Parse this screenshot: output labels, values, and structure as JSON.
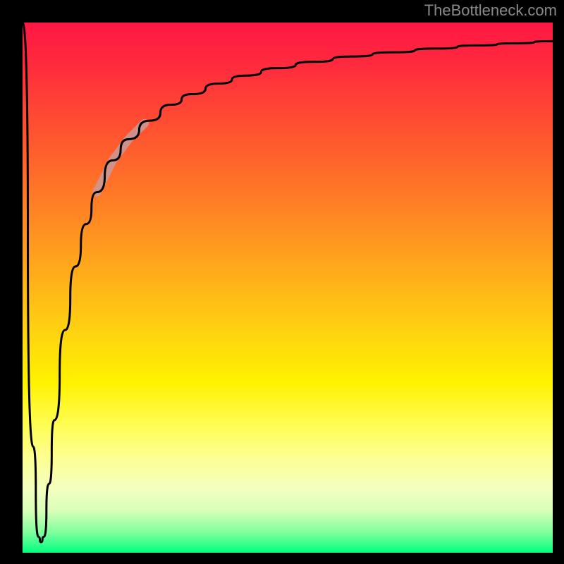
{
  "attribution": "TheBottleneck.com",
  "chart_data": {
    "type": "line",
    "title": "",
    "xlabel": "",
    "ylabel": "",
    "xlim": [
      0,
      1
    ],
    "ylim": [
      0,
      1
    ],
    "background_gradient": {
      "top": "#ff1744",
      "middle": "#fff200",
      "bottom": "#00ff80"
    },
    "series": [
      {
        "name": "main-curve",
        "x": [
          0.0,
          0.02,
          0.03,
          0.035,
          0.04,
          0.05,
          0.06,
          0.08,
          0.1,
          0.12,
          0.14,
          0.17,
          0.2,
          0.24,
          0.28,
          0.32,
          0.37,
          0.42,
          0.48,
          0.55,
          0.62,
          0.7,
          0.78,
          0.86,
          0.93,
          1.0
        ],
        "y": [
          1.0,
          0.2,
          0.03,
          0.02,
          0.03,
          0.13,
          0.25,
          0.42,
          0.54,
          0.62,
          0.68,
          0.74,
          0.78,
          0.815,
          0.845,
          0.865,
          0.885,
          0.9,
          0.914,
          0.926,
          0.936,
          0.944,
          0.951,
          0.957,
          0.961,
          0.965
        ]
      },
      {
        "name": "highlight-segment",
        "x": [
          0.14,
          0.17,
          0.2,
          0.23
        ],
        "y": [
          0.68,
          0.74,
          0.78,
          0.81
        ]
      }
    ],
    "annotations": []
  }
}
